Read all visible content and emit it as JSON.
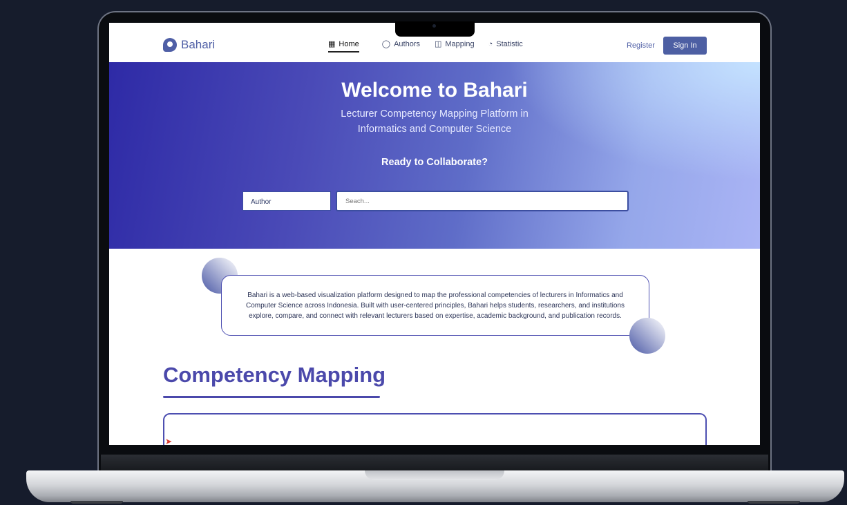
{
  "nav": {
    "logo": "Bahari",
    "links": [
      {
        "label": "Home",
        "icon": "grid-icon"
      },
      {
        "label": "Authors",
        "icon": "person-icon"
      },
      {
        "label": "Mapping",
        "icon": "map-icon"
      },
      {
        "label": "Statistic",
        "icon": "pie-icon"
      }
    ],
    "register": "Register",
    "sign_in": "Sign In"
  },
  "hero": {
    "title": "Welcome to Bahari",
    "subtitle": "Lecturer Competency Mapping Platform in Informatics and Computer Science",
    "cta": "Ready to Collaborate?",
    "select_value": "Author",
    "search_placeholder": "Seach..."
  },
  "about": {
    "text": "Bahari is a web-based visualization platform designed to map the professional competencies of lecturers in Informatics and Computer Science across Indonesia. Built with user-centered principles, Bahari helps students, researchers, and institutions explore, compare, and connect with relevant lecturers based on expertise, academic background, and publication records."
  },
  "mapping": {
    "title": "Competency Mapping"
  },
  "colors": {
    "brand": "#4d5fa3",
    "accent": "#4b49ab"
  }
}
